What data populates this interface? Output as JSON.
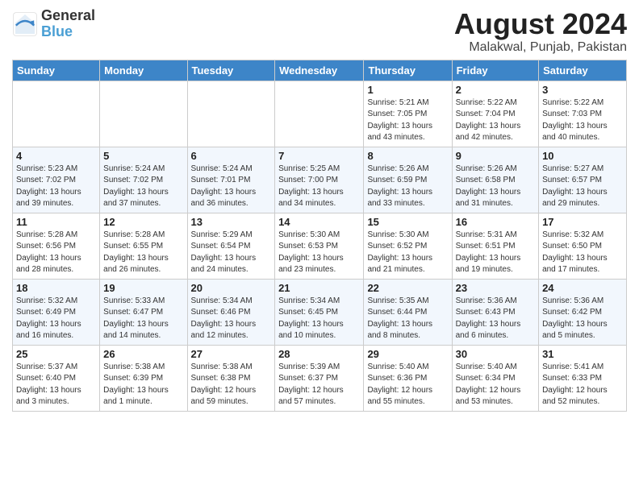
{
  "header": {
    "logo_line1": "General",
    "logo_line2": "Blue",
    "month_year": "August 2024",
    "location": "Malakwal, Punjab, Pakistan"
  },
  "weekdays": [
    "Sunday",
    "Monday",
    "Tuesday",
    "Wednesday",
    "Thursday",
    "Friday",
    "Saturday"
  ],
  "weeks": [
    [
      {
        "day": "",
        "info": ""
      },
      {
        "day": "",
        "info": ""
      },
      {
        "day": "",
        "info": ""
      },
      {
        "day": "",
        "info": ""
      },
      {
        "day": "1",
        "info": "Sunrise: 5:21 AM\nSunset: 7:05 PM\nDaylight: 13 hours\nand 43 minutes."
      },
      {
        "day": "2",
        "info": "Sunrise: 5:22 AM\nSunset: 7:04 PM\nDaylight: 13 hours\nand 42 minutes."
      },
      {
        "day": "3",
        "info": "Sunrise: 5:22 AM\nSunset: 7:03 PM\nDaylight: 13 hours\nand 40 minutes."
      }
    ],
    [
      {
        "day": "4",
        "info": "Sunrise: 5:23 AM\nSunset: 7:02 PM\nDaylight: 13 hours\nand 39 minutes."
      },
      {
        "day": "5",
        "info": "Sunrise: 5:24 AM\nSunset: 7:02 PM\nDaylight: 13 hours\nand 37 minutes."
      },
      {
        "day": "6",
        "info": "Sunrise: 5:24 AM\nSunset: 7:01 PM\nDaylight: 13 hours\nand 36 minutes."
      },
      {
        "day": "7",
        "info": "Sunrise: 5:25 AM\nSunset: 7:00 PM\nDaylight: 13 hours\nand 34 minutes."
      },
      {
        "day": "8",
        "info": "Sunrise: 5:26 AM\nSunset: 6:59 PM\nDaylight: 13 hours\nand 33 minutes."
      },
      {
        "day": "9",
        "info": "Sunrise: 5:26 AM\nSunset: 6:58 PM\nDaylight: 13 hours\nand 31 minutes."
      },
      {
        "day": "10",
        "info": "Sunrise: 5:27 AM\nSunset: 6:57 PM\nDaylight: 13 hours\nand 29 minutes."
      }
    ],
    [
      {
        "day": "11",
        "info": "Sunrise: 5:28 AM\nSunset: 6:56 PM\nDaylight: 13 hours\nand 28 minutes."
      },
      {
        "day": "12",
        "info": "Sunrise: 5:28 AM\nSunset: 6:55 PM\nDaylight: 13 hours\nand 26 minutes."
      },
      {
        "day": "13",
        "info": "Sunrise: 5:29 AM\nSunset: 6:54 PM\nDaylight: 13 hours\nand 24 minutes."
      },
      {
        "day": "14",
        "info": "Sunrise: 5:30 AM\nSunset: 6:53 PM\nDaylight: 13 hours\nand 23 minutes."
      },
      {
        "day": "15",
        "info": "Sunrise: 5:30 AM\nSunset: 6:52 PM\nDaylight: 13 hours\nand 21 minutes."
      },
      {
        "day": "16",
        "info": "Sunrise: 5:31 AM\nSunset: 6:51 PM\nDaylight: 13 hours\nand 19 minutes."
      },
      {
        "day": "17",
        "info": "Sunrise: 5:32 AM\nSunset: 6:50 PM\nDaylight: 13 hours\nand 17 minutes."
      }
    ],
    [
      {
        "day": "18",
        "info": "Sunrise: 5:32 AM\nSunset: 6:49 PM\nDaylight: 13 hours\nand 16 minutes."
      },
      {
        "day": "19",
        "info": "Sunrise: 5:33 AM\nSunset: 6:47 PM\nDaylight: 13 hours\nand 14 minutes."
      },
      {
        "day": "20",
        "info": "Sunrise: 5:34 AM\nSunset: 6:46 PM\nDaylight: 13 hours\nand 12 minutes."
      },
      {
        "day": "21",
        "info": "Sunrise: 5:34 AM\nSunset: 6:45 PM\nDaylight: 13 hours\nand 10 minutes."
      },
      {
        "day": "22",
        "info": "Sunrise: 5:35 AM\nSunset: 6:44 PM\nDaylight: 13 hours\nand 8 minutes."
      },
      {
        "day": "23",
        "info": "Sunrise: 5:36 AM\nSunset: 6:43 PM\nDaylight: 13 hours\nand 6 minutes."
      },
      {
        "day": "24",
        "info": "Sunrise: 5:36 AM\nSunset: 6:42 PM\nDaylight: 13 hours\nand 5 minutes."
      }
    ],
    [
      {
        "day": "25",
        "info": "Sunrise: 5:37 AM\nSunset: 6:40 PM\nDaylight: 13 hours\nand 3 minutes."
      },
      {
        "day": "26",
        "info": "Sunrise: 5:38 AM\nSunset: 6:39 PM\nDaylight: 13 hours\nand 1 minute."
      },
      {
        "day": "27",
        "info": "Sunrise: 5:38 AM\nSunset: 6:38 PM\nDaylight: 12 hours\nand 59 minutes."
      },
      {
        "day": "28",
        "info": "Sunrise: 5:39 AM\nSunset: 6:37 PM\nDaylight: 12 hours\nand 57 minutes."
      },
      {
        "day": "29",
        "info": "Sunrise: 5:40 AM\nSunset: 6:36 PM\nDaylight: 12 hours\nand 55 minutes."
      },
      {
        "day": "30",
        "info": "Sunrise: 5:40 AM\nSunset: 6:34 PM\nDaylight: 12 hours\nand 53 minutes."
      },
      {
        "day": "31",
        "info": "Sunrise: 5:41 AM\nSunset: 6:33 PM\nDaylight: 12 hours\nand 52 minutes."
      }
    ]
  ]
}
